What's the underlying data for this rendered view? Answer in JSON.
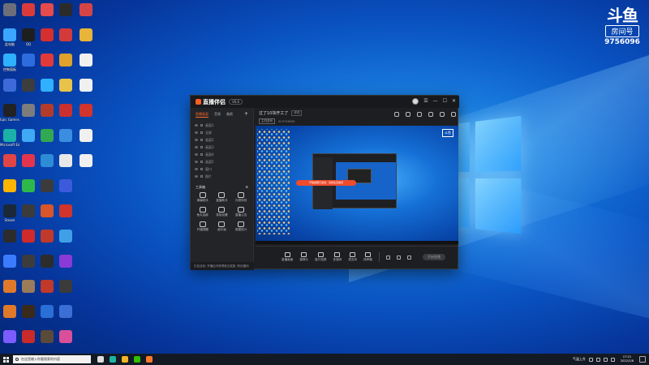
{
  "desktop": {
    "icon_columns": [
      [
        {
          "label": "",
          "color": "#6c6f7a"
        },
        {
          "label": "此电脑",
          "color": "#3aa6ff"
        },
        {
          "label": "控制面板",
          "color": "#2fb0ff"
        },
        {
          "label": "",
          "color": "#3c6bd9"
        },
        {
          "label": "Epic Games",
          "color": "#222222"
        },
        {
          "label": "Microsoft Edge",
          "color": "#1bb0a8"
        },
        {
          "label": "",
          "color": "#e04545"
        },
        {
          "label": "",
          "color": "#ffb400"
        },
        {
          "label": "Steam",
          "color": "#1b2838"
        },
        {
          "label": "",
          "color": "#2c2c2c"
        },
        {
          "label": "",
          "color": "#3b7cff"
        },
        {
          "label": "",
          "color": "#e07a2a"
        },
        {
          "label": "",
          "color": "#e07a2a"
        },
        {
          "label": "",
          "color": "#7b5cff"
        }
      ],
      [
        {
          "label": "",
          "color": "#d93b3b"
        },
        {
          "label": "QQ",
          "color": "#1e1e1e"
        },
        {
          "label": "",
          "color": "#2d6cdf"
        },
        {
          "label": "",
          "color": "#3d3d3d"
        },
        {
          "label": "",
          "color": "#7d7d7d"
        },
        {
          "label": "",
          "color": "#3fa9f5"
        },
        {
          "label": "",
          "color": "#e2354d"
        },
        {
          "label": "",
          "color": "#2fb84a"
        },
        {
          "label": "",
          "color": "#3b3b3b"
        },
        {
          "label": "",
          "color": "#d02a2a"
        },
        {
          "label": "",
          "color": "#3c3c3c"
        },
        {
          "label": "",
          "color": "#9a7b5a"
        },
        {
          "label": "",
          "color": "#3a2a1a"
        },
        {
          "label": "",
          "color": "#c92a2a"
        }
      ],
      [
        {
          "label": "",
          "color": "#e54b4b"
        },
        {
          "label": "",
          "color": "#d62f2f"
        },
        {
          "label": "",
          "color": "#e03a3a"
        },
        {
          "label": "",
          "color": "#30b0ff"
        },
        {
          "label": "",
          "color": "#b33b2a"
        },
        {
          "label": "",
          "color": "#32a852"
        },
        {
          "label": "",
          "color": "#2e8bd6"
        },
        {
          "label": "",
          "color": "#3b3b3b"
        },
        {
          "label": "",
          "color": "#d9552a"
        },
        {
          "label": "",
          "color": "#c0392b"
        },
        {
          "label": "",
          "color": "#2c2c2c"
        },
        {
          "label": "",
          "color": "#c0392b"
        },
        {
          "label": "",
          "color": "#2a6fd6"
        },
        {
          "label": "",
          "color": "#5a4a3a"
        }
      ],
      [
        {
          "label": "",
          "color": "#2b2b2b"
        },
        {
          "label": "",
          "color": "#d33b3b"
        },
        {
          "label": "",
          "color": "#e0a22a"
        },
        {
          "label": "",
          "color": "#e8c34a"
        },
        {
          "label": "",
          "color": "#cc2f2f"
        },
        {
          "label": "",
          "color": "#3a8de0"
        },
        {
          "label": "",
          "color": "#e8e8e8"
        },
        {
          "label": "",
          "color": "#3b5bdc"
        },
        {
          "label": "",
          "color": "#d0342c"
        },
        {
          "label": "",
          "color": "#3fa0e8"
        },
        {
          "label": "",
          "color": "#8a3ad6"
        },
        {
          "label": "",
          "color": "#3b3b3b"
        },
        {
          "label": "",
          "color": "#3b6fd6"
        },
        {
          "label": "",
          "color": "#d94f9a"
        }
      ],
      [
        {
          "label": "",
          "color": "#d64545"
        },
        {
          "label": "",
          "color": "#e8b43a"
        },
        {
          "label": "",
          "color": "#f0f0f0"
        },
        {
          "label": "",
          "color": "#f0f0f0"
        },
        {
          "label": "",
          "color": "#d0342c"
        },
        {
          "label": "",
          "color": "#f0f0f0"
        },
        {
          "label": "",
          "color": "#f0f0f0"
        }
      ]
    ]
  },
  "room_badge": {
    "logo": "斗鱼",
    "label": "房间号",
    "number": "9756096"
  },
  "app": {
    "name": "直播伴侣",
    "version": "V6.6",
    "left_tabs": [
      "直播画面",
      "音频",
      "美颜"
    ],
    "scenes": [
      "画面1",
      "全屏",
      "画面2",
      "画面3",
      "画面4",
      "画面5",
      "窗口",
      "图片"
    ],
    "tools_title": "工具箱",
    "tools": [
      "弹幕助手",
      "直播助手",
      "礼物特效",
      "鱼丸抽奖",
      "录制设置",
      "直播公告",
      "开播提醒",
      "画中画",
      "数据统计"
    ],
    "left_bottom": "礼包活动: 开播后可获得鱼丸奖励, 粉丝福利",
    "stream_title": "过了10块开工了",
    "edit_label": "修改",
    "category": "主机游戏",
    "meta": "ID:9756096",
    "preview_pill": "开播提醒已发送，请前往直播间",
    "preview_badge": "斗鱼",
    "controls": [
      "直播画面",
      "摄像头",
      "窗口投屏",
      "多媒体",
      "麦克风",
      "扬声器"
    ],
    "live_button": "开始直播"
  },
  "taskbar": {
    "search_placeholder": "在这里输入你要搜索的内容",
    "apps": [
      {
        "name": "task-view",
        "color": "#dddddd"
      },
      {
        "name": "edge",
        "color": "#1fb3a4"
      },
      {
        "name": "explorer",
        "color": "#f0b429"
      },
      {
        "name": "wechat",
        "color": "#2dc100"
      },
      {
        "name": "douyu",
        "color": "#ff7a2b"
      }
    ],
    "weather": "气温上升",
    "time": "17:21",
    "date": "2022/2/8"
  }
}
